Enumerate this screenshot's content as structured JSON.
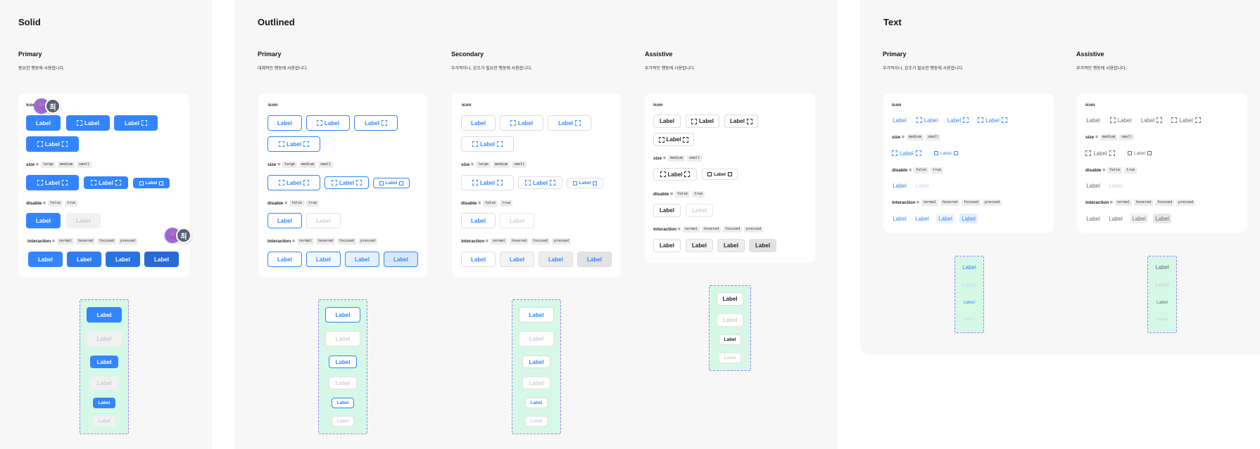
{
  "sections": {
    "solid": "Solid",
    "outlined": "Outlined",
    "text": "Text"
  },
  "groups": {
    "solid_primary": {
      "title": "Primary",
      "desc": "중요한 행동에 사용합니다."
    },
    "outlined_primary": {
      "title": "Primary",
      "desc": "대체적인 행동에 사용합니다."
    },
    "outlined_secondary": {
      "title": "Secondary",
      "desc": "부가적이나, 강조가 필요한 행동에 사용합니다."
    },
    "outlined_assistive": {
      "title": "Assistive",
      "desc": "부가적인 행동에 사용합니다."
    },
    "text_primary": {
      "title": "Primary",
      "desc": "부가적이나, 강조가 필요한 행동에 사용합니다."
    },
    "text_assistive": {
      "title": "Assistive",
      "desc": "부가적인 행동에 사용합니다."
    }
  },
  "props": {
    "icon": "icon",
    "size": "size =",
    "disable": "disable =",
    "interaction": "interaction ="
  },
  "values": {
    "large": "large",
    "medium": "medium",
    "small": "small",
    "false": "false",
    "true": "true",
    "normal": "normal",
    "hovered": "hovered",
    "focused": "focused",
    "pressed": "pressed"
  },
  "button_label": "Label",
  "avatar": {
    "blob_emoji": "👾",
    "initial": "최"
  },
  "colors": {
    "primary": "#3385ff",
    "strip_fill": "#d6f8e6",
    "strip_border": "#a67cf5"
  }
}
